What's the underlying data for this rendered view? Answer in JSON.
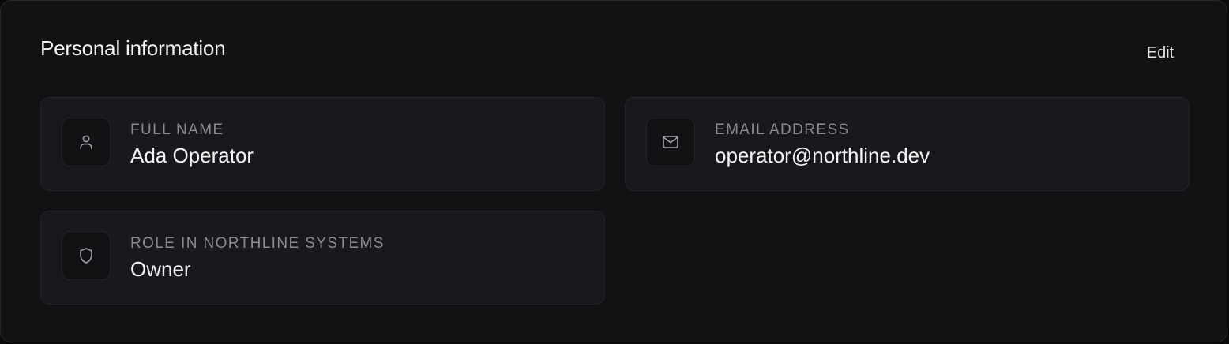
{
  "section": {
    "title": "Personal information",
    "edit_label": "Edit"
  },
  "fields": [
    {
      "label": "Full name",
      "value": "Ada Operator",
      "icon": "user-icon"
    },
    {
      "label": "Email address",
      "value": "operator@northline.dev",
      "icon": "mail-icon"
    },
    {
      "label": "Role in Northline Systems",
      "value": "Owner",
      "icon": "shield-icon"
    }
  ],
  "colors": {
    "page_background": "#0a0a0b",
    "panel_background": "#111214",
    "card_background": "#18191d",
    "border": "#24252a",
    "label_text": "#8b8b93",
    "value_text": "#f4f4f5",
    "icon_stroke": "#a1a1aa"
  }
}
